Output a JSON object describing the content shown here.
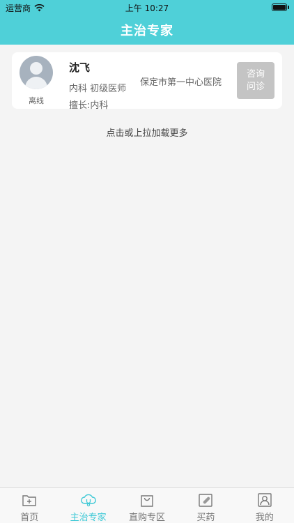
{
  "status_bar": {
    "carrier": "运营商",
    "time": "上午 10:27"
  },
  "header": {
    "title": "主治专家"
  },
  "doctor_card": {
    "name": "沈飞",
    "title": "内科 初级医师",
    "hospital": "保定市第一中心医院",
    "specialty": "擅长:内科",
    "status": "离线",
    "consult_line1": "咨询",
    "consult_line2": "问诊"
  },
  "list": {
    "load_more": "点击或上拉加载更多"
  },
  "tabbar": {
    "active_color": "#3ec9d6",
    "items": [
      {
        "label": "首页",
        "icon": "home-icon"
      },
      {
        "label": "主治专家",
        "icon": "expert-icon"
      },
      {
        "label": "直购专区",
        "icon": "shopping-bag-icon"
      },
      {
        "label": "买药",
        "icon": "medicine-icon"
      },
      {
        "label": "我的",
        "icon": "profile-icon"
      }
    ]
  }
}
